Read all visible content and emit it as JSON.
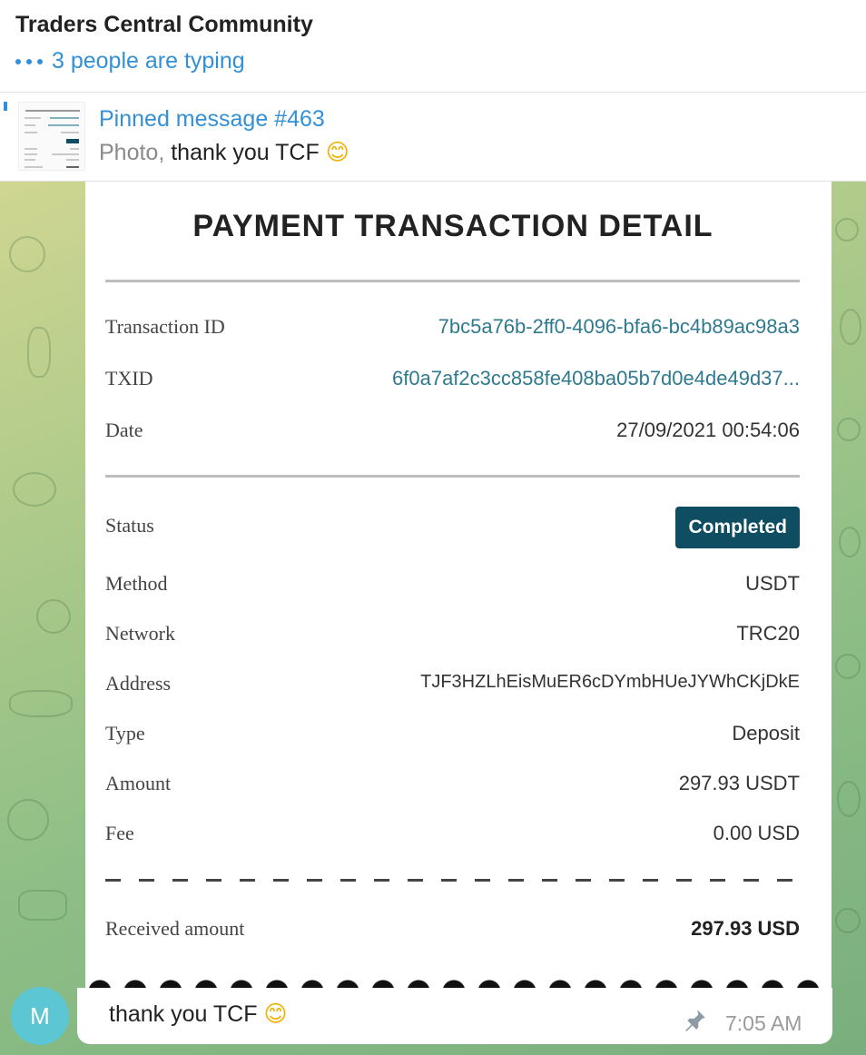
{
  "header": {
    "title": "Traders Central Community",
    "typing_status": "3 people are typing"
  },
  "pinned": {
    "title": "Pinned message #463",
    "preview_type": "Photo,",
    "preview_text": "thank you TCF",
    "preview_emoji": "😊"
  },
  "receipt": {
    "heading": "PAYMENT TRANSACTION DETAIL",
    "rows_top": [
      {
        "label": "Transaction ID",
        "value": "7bc5a76b-2ff0-4096-bfa6-bc4b89ac98a3"
      },
      {
        "label": "TXID",
        "value": "6f0a7af2c3cc858fe408ba05b7d0e4de49d37..."
      },
      {
        "label": "Date",
        "value": "27/09/2021 00:54:06"
      }
    ],
    "status_label": "Status",
    "status_value": "Completed",
    "rows_mid": [
      {
        "label": "Method",
        "value": "USDT"
      },
      {
        "label": "Network",
        "value": "TRC20"
      },
      {
        "label": "Address",
        "value": "TJF3HZLhEisMuER6cDYmbHUeJYWhCKjDkE"
      },
      {
        "label": "Type",
        "value": "Deposit"
      },
      {
        "label": "Amount",
        "value": "297.93 USDT"
      },
      {
        "label": "Fee",
        "value": "0.00 USD"
      }
    ],
    "received_label": "Received amount",
    "received_value": "297.93 USD"
  },
  "message": {
    "avatar_initial": "M",
    "caption": "thank you TCF",
    "caption_emoji": "😊",
    "time": "7:05 AM",
    "pinned_icon": "pin-icon"
  },
  "colors": {
    "accent": "#3390d6",
    "status_badge": "#0e4d62",
    "link": "#2f7a8f",
    "avatar": "#5cc6d3"
  }
}
